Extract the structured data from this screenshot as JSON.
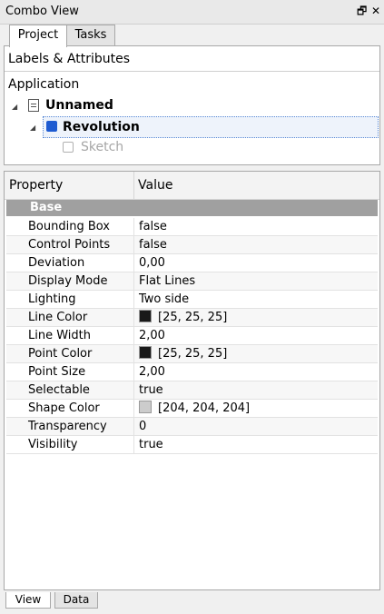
{
  "window": {
    "title": "Combo View",
    "float_icon": "restore-icon",
    "close_icon": "close-icon"
  },
  "top_tabs": [
    {
      "label": "Project",
      "active": true
    },
    {
      "label": "Tasks",
      "active": false
    }
  ],
  "tree": {
    "header": "Labels & Attributes",
    "root": "Application",
    "document": {
      "label": "Unnamed",
      "icon": "document-icon"
    },
    "feature": {
      "label": "Revolution",
      "icon": "solid-cube-icon",
      "color": "#1e5bd1"
    },
    "child": {
      "label": "Sketch",
      "icon": "sketch-icon"
    }
  },
  "properties": {
    "col_property": "Property",
    "col_value": "Value",
    "group": "Base",
    "rows": [
      {
        "name": "Bounding Box",
        "value": "false"
      },
      {
        "name": "Control Points",
        "value": "false"
      },
      {
        "name": "Deviation",
        "value": "0,00"
      },
      {
        "name": "Display Mode",
        "value": "Flat Lines"
      },
      {
        "name": "Lighting",
        "value": "Two side"
      },
      {
        "name": "Line Color",
        "value": "[25, 25, 25]",
        "swatch": "#191919"
      },
      {
        "name": "Line Width",
        "value": "2,00"
      },
      {
        "name": "Point Color",
        "value": "[25, 25, 25]",
        "swatch": "#191919"
      },
      {
        "name": "Point Size",
        "value": "2,00"
      },
      {
        "name": "Selectable",
        "value": "true"
      },
      {
        "name": "Shape Color",
        "value": "[204, 204, 204]",
        "swatch": "#cccccc"
      },
      {
        "name": "Transparency",
        "value": "0"
      },
      {
        "name": "Visibility",
        "value": "true"
      }
    ]
  },
  "bottom_tabs": [
    {
      "label": "View",
      "active": true
    },
    {
      "label": "Data",
      "active": false
    }
  ]
}
